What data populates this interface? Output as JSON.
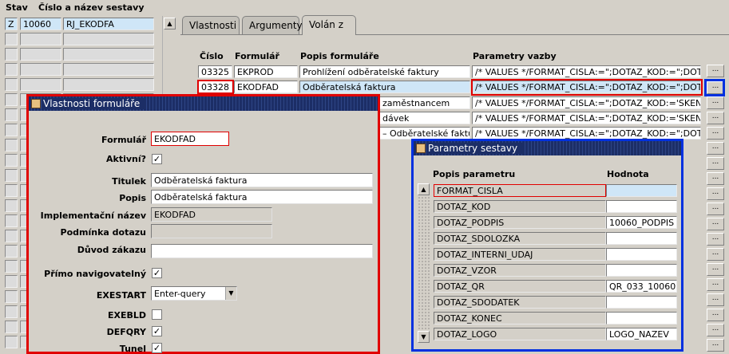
{
  "left_panel": {
    "col_stav": "Stav",
    "col_cislo": "Číslo a název sestavy",
    "row": {
      "stav": "Z",
      "cislo": "10060",
      "nazev": "RJ_EKODFA"
    }
  },
  "tabs": [
    {
      "label": "Vlastnosti"
    },
    {
      "label": "Argumenty"
    },
    {
      "label": "Volán z"
    }
  ],
  "grid": {
    "headers": {
      "cislo": "Číslo",
      "formular": "Formulář",
      "popis": "Popis formuláře",
      "parametry": "Parametry vazby"
    },
    "rows": [
      {
        "cislo": "03325",
        "formular": "EKPROD",
        "popis": "Prohlížení odběratelské faktury",
        "parametry": "/* VALUES */FORMAT_CISLA:=\";DOTAZ_KOD:=\";DOTAZ_P"
      },
      {
        "cislo": "03328",
        "formular": "EKODFAD",
        "popis": "Odběratelská faktura",
        "parametry": "/* VALUES */FORMAT_CISLA:=\";DOTAZ_KOD:=\";DOTAZ_P"
      },
      {
        "cislo": "",
        "formular": "",
        "popis": "zaměstnancem",
        "parametry": "/* VALUES */FORMAT_CISLA:=\";DOTAZ_KOD:='SKEN_KOD"
      },
      {
        "cislo": "",
        "formular": "",
        "popis": "dávek",
        "parametry": "/* VALUES */FORMAT_CISLA:=\";DOTAZ_KOD:='SKEN_KOD"
      },
      {
        "cislo": "",
        "formular": "",
        "popis": "– Odběratelské faktury",
        "parametry": "/* VALUES */FORMAT_CISLA:=\";DOTAZ_KOD:=\";DOTAZ_P"
      }
    ],
    "more_button": "..."
  },
  "form_window": {
    "title": "Vlastnosti formuláře",
    "labels": {
      "formular": "Formulář",
      "aktivni": "Aktivní?",
      "titulek": "Titulek",
      "popis": "Popis",
      "impl": "Implementační název",
      "podminka": "Podmínka dotazu",
      "duvod": "Důvod zákazu",
      "primo": "Přímo navigovatelný",
      "exestart": "EXESTART",
      "exebld": "EXEBLD",
      "defqry": "DEFQRY",
      "tunel": "Tunel"
    },
    "values": {
      "formular": "EKODFAD",
      "titulek": "Odběratelská faktura",
      "popis": "Odběratelská faktura",
      "impl": "EKODFAD",
      "podminka": "",
      "duvod": "",
      "exestart": "Enter-query"
    },
    "checks": {
      "aktivni": true,
      "primo": true,
      "exebld": false,
      "defqry": true,
      "tunel": true
    }
  },
  "param_window": {
    "title": "Parametry sestavy",
    "col_popis": "Popis parametru",
    "col_hodnota": "Hodnota",
    "rows": [
      {
        "name": "FORMAT_CISLA",
        "value": ""
      },
      {
        "name": "DOTAZ_KOD",
        "value": ""
      },
      {
        "name": "DOTAZ_PODPIS",
        "value": "10060_PODPIS"
      },
      {
        "name": "DOTAZ_SDOLOZKA",
        "value": ""
      },
      {
        "name": "DOTAZ_INTERNI_UDAJ",
        "value": ""
      },
      {
        "name": "DOTAZ_VZOR",
        "value": ""
      },
      {
        "name": "DOTAZ_QR",
        "value": "QR_033_10060"
      },
      {
        "name": "DOTAZ_SDODATEK",
        "value": ""
      },
      {
        "name": "DOTAZ_KONEC",
        "value": ""
      },
      {
        "name": "DOTAZ_LOGO",
        "value": "LOGO_NAZEV"
      }
    ]
  },
  "colors": {
    "highlight_red": "#e00000",
    "highlight_blue": "#0030e0",
    "title_bar": "#1c2e66",
    "selected_row": "#cfe6f7"
  }
}
